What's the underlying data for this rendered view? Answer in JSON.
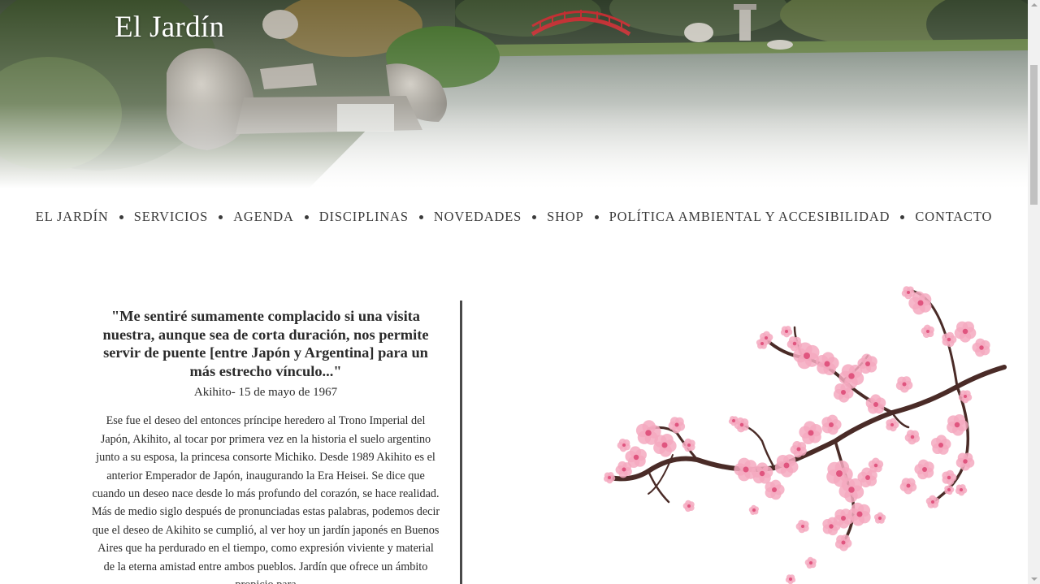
{
  "site": {
    "title": "El Jardín"
  },
  "nav": {
    "items": [
      {
        "label": "EL JARDÍN"
      },
      {
        "label": "SERVICIOS"
      },
      {
        "label": "AGENDA"
      },
      {
        "label": "DISCIPLINAS"
      },
      {
        "label": "NOVEDADES"
      },
      {
        "label": "SHOP"
      },
      {
        "label": "POLÍTICA AMBIENTAL Y ACCESIBILIDAD"
      },
      {
        "label": "CONTACTO"
      }
    ]
  },
  "main": {
    "quote": "\"Me sentiré sumamente complacido si una visita nuestra, aunque sea de corta duración, nos permite servir de puente [entre Japón y Argentina] para un más estrecho vínculo...\"",
    "author": "Akihito- 15 de mayo de 1967",
    "body": "Ese fue el deseo del entonces príncipe heredero al Trono Imperial del Japón, Akihito, al tocar por primera vez en la historia el suelo argentino junto a su esposa, la princesa consorte Michiko. Desde 1989 Akihito es el anterior Emperador de Japón, inaugurando la Era Heisei. Se dice que cuando un deseo nace desde lo más profundo del corazón, se hace realidad. Más de medio siglo después de pronunciadas estas palabras, podemos decir que el deseo de Akihito se cumplió, al ver hoy un jardín japonés en Buenos Aires que ha perdurado en el tiempo, como expresión viviente y material de la eterna amistad entre ambos pueblos. Jardín que ofrece un ámbito propicio para"
  },
  "colors": {
    "text": "#2b2b2b",
    "blossom_pink": "#f4a9c0",
    "blossom_dark": "#e0557f",
    "branch": "#4a2b27",
    "bridge_red": "#c0282c"
  },
  "icons": {
    "hero": "japanese-garden-photo",
    "illustration": "cherry-blossom-branch"
  }
}
